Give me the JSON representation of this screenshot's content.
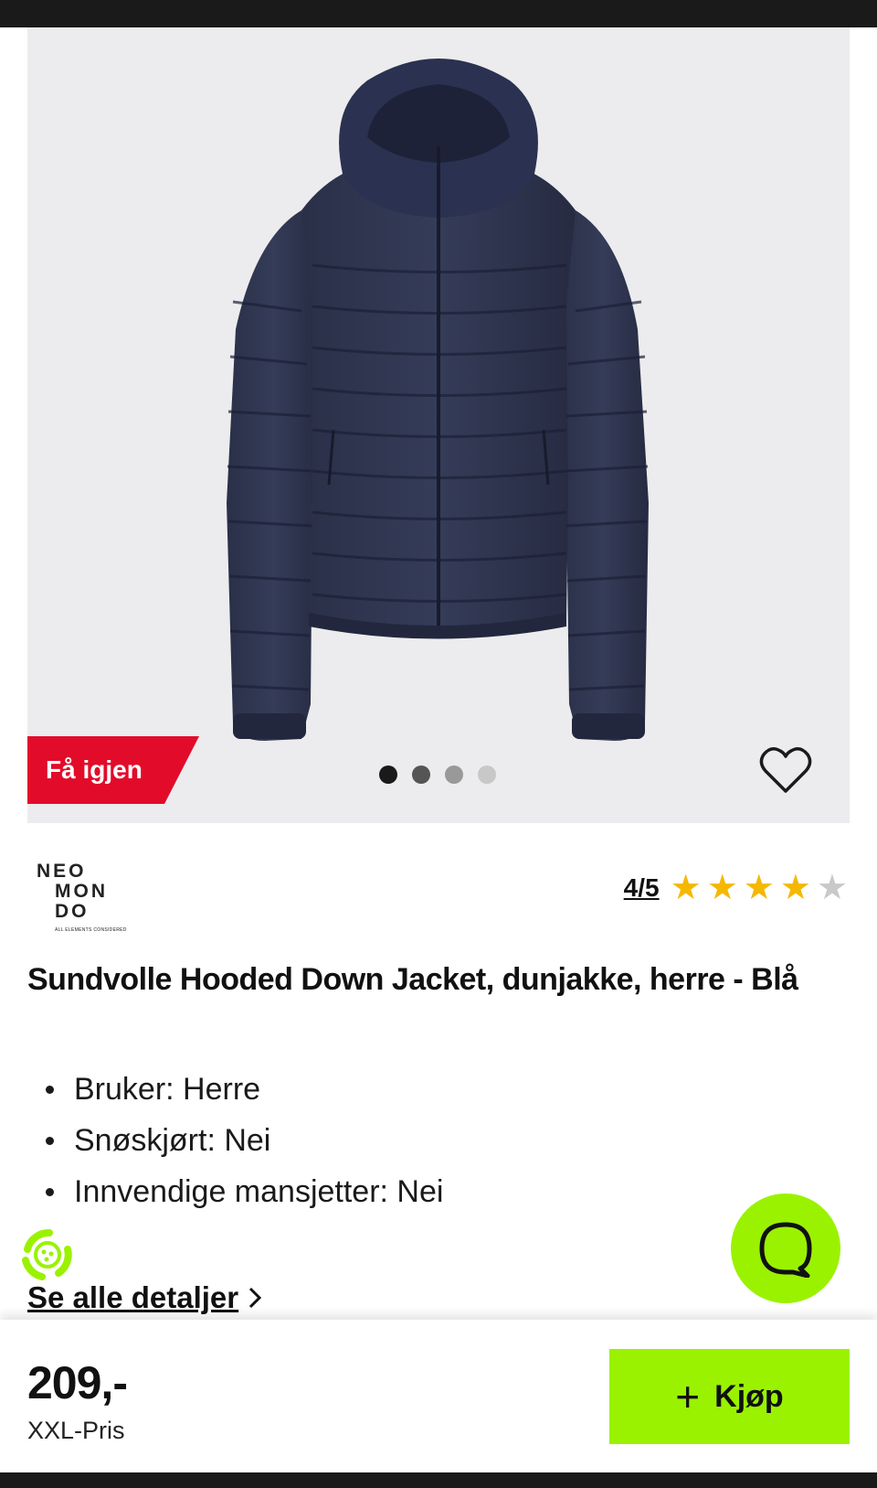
{
  "gallery": {
    "promo_badge": "Få igjen",
    "promo_color": "#e30b2a",
    "image_count": 4,
    "active_image": 1,
    "dot_colors": [
      "#1a1a1a",
      "#555555",
      "#999999",
      "#c8c8c8"
    ],
    "favorite_icon": "heart-outline-icon"
  },
  "brand": {
    "logo_lines": [
      "NEO",
      "MON",
      "DO"
    ],
    "logo_tagline": "ALL ELEMENTS CONSIDERED"
  },
  "rating": {
    "text": "4/5",
    "value": 4,
    "max": 5,
    "filled_color": "#f5b800",
    "empty_color": "#c9c9c9"
  },
  "product": {
    "title": "Sundvolle Hooded Down Jacket, dunjakke, herre - Blå",
    "features": [
      "Bruker: Herre",
      "Snøskjørt: Nei",
      "Innvendige mansjetter: Nei"
    ],
    "details_link": "Se alle detaljer"
  },
  "footer": {
    "price": "209,-",
    "price_label": "XXL-Pris",
    "buy_label": "Kjøp",
    "accent_color": "#9af200"
  },
  "chat": {
    "icon": "chat-bubble-icon"
  },
  "eco": {
    "icon": "recycle-icon"
  }
}
